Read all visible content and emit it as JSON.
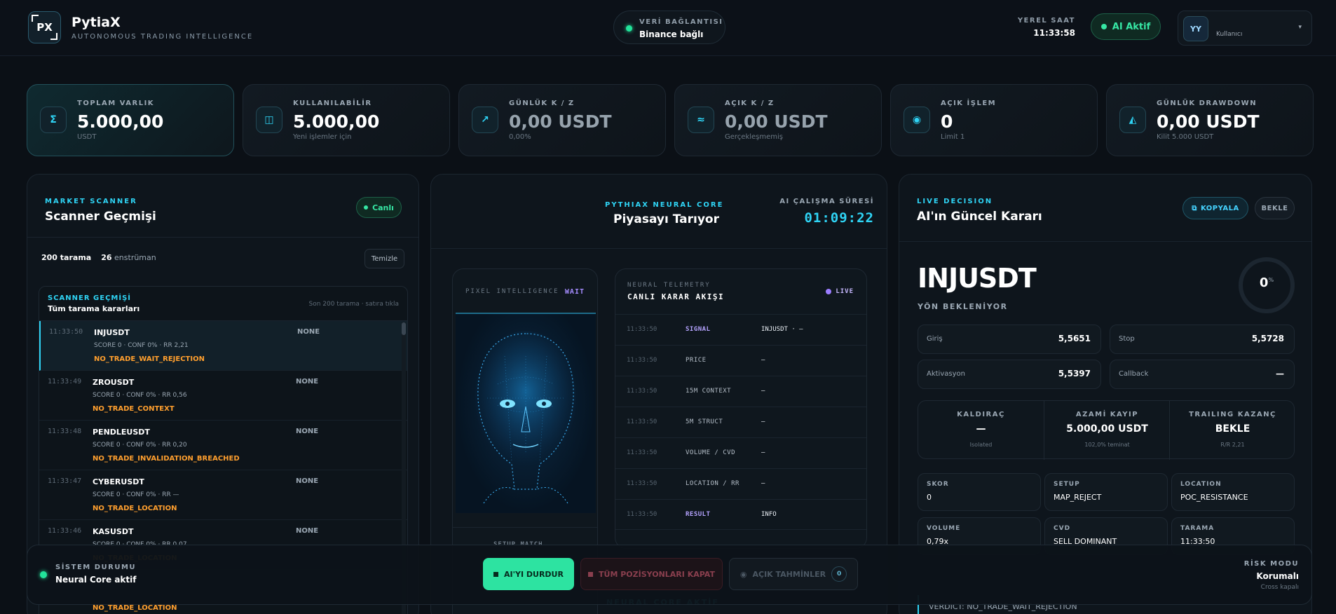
{
  "header": {
    "logo": "PX",
    "brand": "PytiaX",
    "tagline": "AUTONOMOUS TRADING INTELLIGENCE",
    "connection_label": "VERİ BAĞLANTISI",
    "connection_value": "Binance bağlı",
    "clock_label": "YEREL SAAT",
    "clock_value": "11:33:58",
    "ai_status": "AI Aktif",
    "user_initials": "YY",
    "user_name": "Kullanıcı",
    "user_menu_icon": "▾"
  },
  "stats": [
    {
      "icon": "Σ",
      "label": "TOPLAM VARLIK",
      "value": "5.000,00",
      "sub": "USDT"
    },
    {
      "icon": "◫",
      "label": "KULLANILABİLİR",
      "value": "5.000,00",
      "sub": "Yeni işlemler için"
    },
    {
      "icon": "↗",
      "label": "GÜNLÜK K / Z",
      "value": "0,00 USDT",
      "sub": "0,00%"
    },
    {
      "icon": "≈",
      "label": "AÇIK K / Z",
      "value": "0,00 USDT",
      "sub": "Gerçekleşmemiş"
    },
    {
      "icon": "◉",
      "label": "AÇIK İŞLEM",
      "value": "0",
      "sub": "Limit 1"
    },
    {
      "icon": "◭",
      "label": "GÜNLÜK DRAWDOWN",
      "value": "0,00 USDT",
      "sub": "Kilit 5.000 USDT"
    }
  ],
  "scanner": {
    "kicker": "MARKET SCANNER",
    "title": "Scanner Geçmişi",
    "live": "Canlı",
    "scans": "200 tarama",
    "instruments": "26",
    "instruments_label": "enstrüman",
    "clear": "Temizle",
    "history_kicker": "SCANNER GEÇMİŞİ",
    "history_title": "Tüm tarama kararları",
    "history_note": "Son 200 tarama · satıra tıkla",
    "rows": [
      {
        "time": "11:33:50",
        "symbol": "INJUSDT",
        "meta": "SCORE 0 · CONF 0% · RR 2,21",
        "reason": "NO_TRADE_WAIT_REJECTION",
        "side": "NONE"
      },
      {
        "time": "11:33:49",
        "symbol": "ZROUSDT",
        "meta": "SCORE 0 · CONF 0% · RR 0,56",
        "reason": "NO_TRADE_CONTEXT",
        "side": "NONE"
      },
      {
        "time": "11:33:48",
        "symbol": "PENDLEUSDT",
        "meta": "SCORE 0 · CONF 0% · RR 0,20",
        "reason": "NO_TRADE_INVALIDATION_BREACHED",
        "side": "NONE"
      },
      {
        "time": "11:33:47",
        "symbol": "CYBERUSDT",
        "meta": "SCORE 0 · CONF 0% · RR —",
        "reason": "NO_TRADE_LOCATION",
        "side": "NONE"
      },
      {
        "time": "11:33:46",
        "symbol": "KASUSDT",
        "meta": "SCORE 0 · CONF 0% · RR 0,07",
        "reason": "NO_TRADE_LOCATION",
        "side": "NONE"
      }
    ]
  },
  "core": {
    "kicker": "PYTHIAX NEURAL CORE",
    "title": "Piyasayı Tarıyor",
    "uptime_label": "AI ÇALIŞMA SÜRESİ",
    "uptime": "01:09:22",
    "pixel_label": "PIXEL INTELLIGENCE",
    "pixel_state": "WAIT",
    "pixel_footer": "SETUP MATCH",
    "telemetry_kicker": "NEURAL TELEMETRY",
    "telemetry_title": "CANLI KARAR AKIŞI",
    "telemetry_live": "LIVE",
    "telemetry": [
      {
        "time": "11:33:50",
        "key": "SIGNAL",
        "value": "INJUSDT · —"
      },
      {
        "time": "11:33:50",
        "key": "PRICE",
        "value": "—"
      },
      {
        "time": "11:33:50",
        "key": "15M CONTEXT",
        "value": "—"
      },
      {
        "time": "11:33:50",
        "key": "5M STRUCT",
        "value": "—"
      },
      {
        "time": "11:33:50",
        "key": "VOLUME / CVD",
        "value": "—"
      },
      {
        "time": "11:33:50",
        "key": "LOCATION / RR",
        "value": "—"
      },
      {
        "time": "11:33:50",
        "key": "RESULT",
        "value": "INFO"
      }
    ],
    "activity": "NEURAL CORE AKTİF"
  },
  "decision": {
    "kicker": "LIVE DECISION",
    "title": "AI'ın Güncel Kararı",
    "copy": "KOPYALA",
    "wait": "BEKLE",
    "symbol": "INJUSDT",
    "direction": "YÖN BEKLENİYOR",
    "confidence": "0",
    "confidence_unit": "%",
    "entry_label": "Giriş",
    "entry": "5,5651",
    "stop_label": "Stop",
    "stop": "5,5728",
    "activation_label": "Aktivasyon",
    "activation": "5,5397",
    "callback_label": "Callback",
    "callback": "—",
    "leverage_label": "KALDIRAÇ",
    "leverage": "—",
    "leverage_sub": "Isolated",
    "maxloss_label": "AZAMİ KAYIP",
    "maxloss": "5.000,00 USDT",
    "maxloss_sub": "102,0% teminat",
    "trailing_label": "TRAILING KAZANÇ",
    "trailing": "BEKLE",
    "trailing_sub": "R/R 2,21",
    "grid": [
      {
        "k": "SKOR",
        "v": "0"
      },
      {
        "k": "SETUP",
        "v": "MAP_REJECT"
      },
      {
        "k": "LOCATION",
        "v": "POC_RESISTANCE"
      },
      {
        "k": "VOLUME",
        "v": "0,79x"
      },
      {
        "k": "CVD",
        "v": "SELL DOMINANT"
      },
      {
        "k": "TARAMA",
        "v": "11:33:50"
      }
    ],
    "verdict": "VERDICT: NO_TRADE_WAIT_REJECTION"
  },
  "bottom": {
    "status_label": "SİSTEM DURUMU",
    "status_value": "Neural Core aktif",
    "stop_ai": "AI'YI DURDUR",
    "close_all": "TÜM POZİSYONLARI KAPAT",
    "open_preds": "AÇIK TAHMİNLER",
    "open_preds_count": "0",
    "risk_label": "RİSK MODU",
    "risk_value": "Korumalı",
    "risk_sub": "Cross kapalı"
  }
}
